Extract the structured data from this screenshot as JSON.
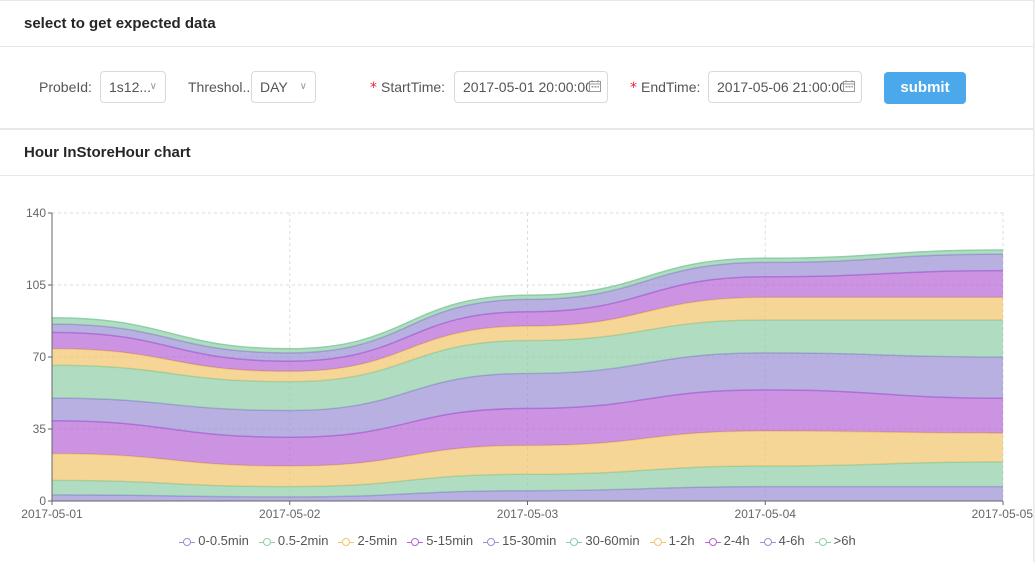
{
  "filter_card": {
    "title": "select to get expected data"
  },
  "form": {
    "probe_label": "ProbeId",
    "probe_value": "1s12...",
    "threshold_label": "Threshol...",
    "threshold_value": "DAY",
    "start_label": "StartTime",
    "start_value": "2017-05-01 20:00:00",
    "end_label": "EndTime",
    "end_value": "2017-05-06 21:00:00",
    "submit_label": "submit"
  },
  "chart_card": {
    "title": "Hour InStoreHour chart"
  },
  "chart_data": {
    "type": "area",
    "stacked": true,
    "smooth": true,
    "categories": [
      "2017-05-01",
      "2017-05-02",
      "2017-05-03",
      "2017-05-04",
      "2017-05-05"
    ],
    "ylim": [
      0,
      140
    ],
    "yticks": [
      0,
      35,
      70,
      105,
      140
    ],
    "grid": true,
    "legend_position": "bottom",
    "series": [
      {
        "name": "0-0.5min",
        "color": "#9b8fd6",
        "values": [
          3,
          2,
          5,
          7,
          7
        ]
      },
      {
        "name": "0.5-2min",
        "color": "#8fcfa8",
        "values": [
          7,
          5,
          8,
          10,
          12
        ]
      },
      {
        "name": "2-5min",
        "color": "#f2c46b",
        "values": [
          13,
          10,
          14,
          17,
          14
        ]
      },
      {
        "name": "5-15min",
        "color": "#b565d6",
        "values": [
          16,
          14,
          18,
          20,
          17
        ]
      },
      {
        "name": "15-30min",
        "color": "#9b8fd6",
        "values": [
          11,
          13,
          17,
          18,
          20
        ]
      },
      {
        "name": "30-60min",
        "color": "#8fcfa8",
        "values": [
          16,
          14,
          16,
          16,
          18
        ]
      },
      {
        "name": "1-2h",
        "color": "#f2c46b",
        "values": [
          8,
          5,
          7,
          11,
          11
        ]
      },
      {
        "name": "2-4h",
        "color": "#b565d6",
        "values": [
          8,
          5,
          7,
          10,
          13
        ]
      },
      {
        "name": "4-6h",
        "color": "#9b8fd6",
        "values": [
          4,
          4,
          6,
          7,
          8
        ]
      },
      {
        "name": ">6h",
        "color": "#8fcfa8",
        "values": [
          3,
          2,
          2,
          2,
          2
        ]
      }
    ]
  }
}
